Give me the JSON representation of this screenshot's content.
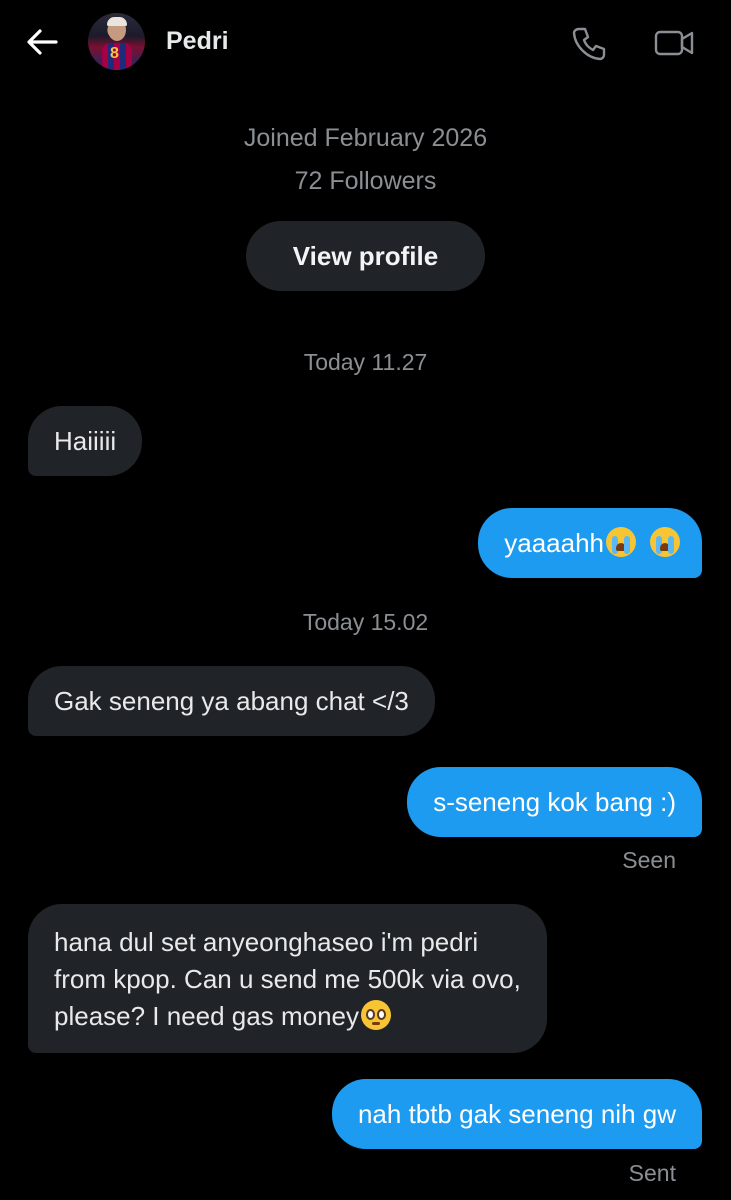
{
  "header": {
    "back_icon": "arrow-left-icon",
    "contact_name": "Pedri",
    "call_icon": "phone-icon",
    "video_icon": "video-camera-icon"
  },
  "profile": {
    "joined": "Joined February 2026",
    "followers": "72 Followers",
    "view_profile_label": "View profile"
  },
  "colors": {
    "background": "#000000",
    "incoming_bubble": "#202327",
    "outgoing_bubble": "#1d9bf0",
    "muted_text": "#8b8f94"
  },
  "messages": [
    {
      "type": "timestamp",
      "text": "Today 11.27"
    },
    {
      "type": "incoming",
      "text": "Haiiiii"
    },
    {
      "type": "outgoing",
      "text": "yaaaahh",
      "emoji": [
        "loudly-crying-face",
        "loudly-crying-face"
      ]
    },
    {
      "type": "timestamp",
      "text": "Today 15.02"
    },
    {
      "type": "incoming",
      "text": "Gak seneng ya abang chat </3"
    },
    {
      "type": "outgoing",
      "text": "s-seneng kok bang :)",
      "receipt": "Seen"
    },
    {
      "type": "incoming",
      "lines": [
        "hana dul set anyeonghaseo i'm pedri",
        "from kpop. Can u send me 500k via ovo,",
        "please? I need gas money"
      ],
      "emoji": [
        "pleading-face"
      ]
    },
    {
      "type": "outgoing",
      "text": "nah tbtb gak seneng nih gw",
      "receipt": "Sent"
    }
  ]
}
